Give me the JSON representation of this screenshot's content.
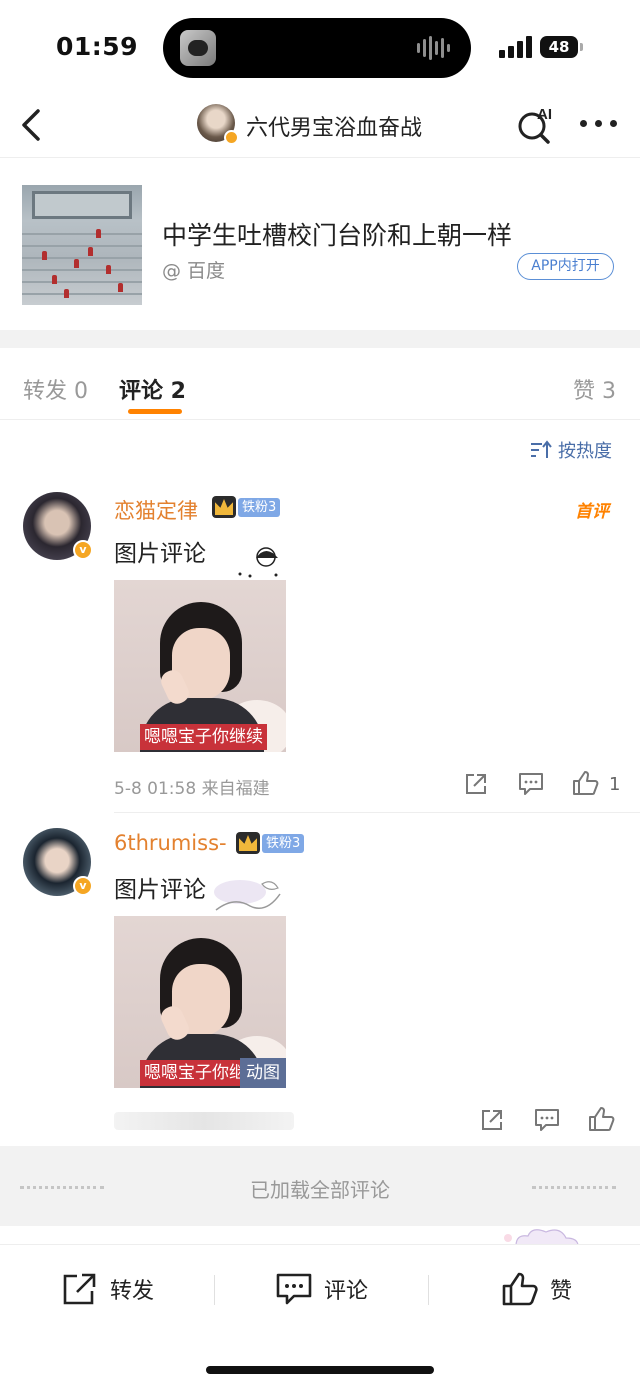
{
  "status_bar": {
    "time": "01:59",
    "battery": "48"
  },
  "nav": {
    "title": "六代男宝浴血奋战",
    "ai_label": "AI"
  },
  "source_card": {
    "title": "中学生吐槽校门台阶和上朝一样",
    "source": "@ 百度",
    "open_in_app": "APP内打开"
  },
  "tabs": {
    "repost": "转发 0",
    "comment": "评论 2",
    "like": "赞 3"
  },
  "sort_label": "按热度",
  "comments": [
    {
      "name": "恋猫定律",
      "fan_badge": "铁粉3",
      "first_tag": "首评",
      "text": "图片评论",
      "image_caption": "嗯嗯宝子你继续",
      "meta": "5-8 01:58  来自福建",
      "like_count": "1"
    },
    {
      "name": "6thrumiss-",
      "fan_badge": "铁粉3",
      "text": "图片评论",
      "image_caption": "嗯嗯宝子你继",
      "gif_tag": "动图"
    }
  ],
  "loaded_all": "已加载全部评论",
  "bottom_bar": {
    "repost": "转发",
    "comment": "评论",
    "like": "赞"
  },
  "colors": {
    "accent": "#ff8200",
    "username": "#e3812f",
    "link_blue": "#4a7fd0",
    "fan_badge": "#7fa8e6"
  }
}
